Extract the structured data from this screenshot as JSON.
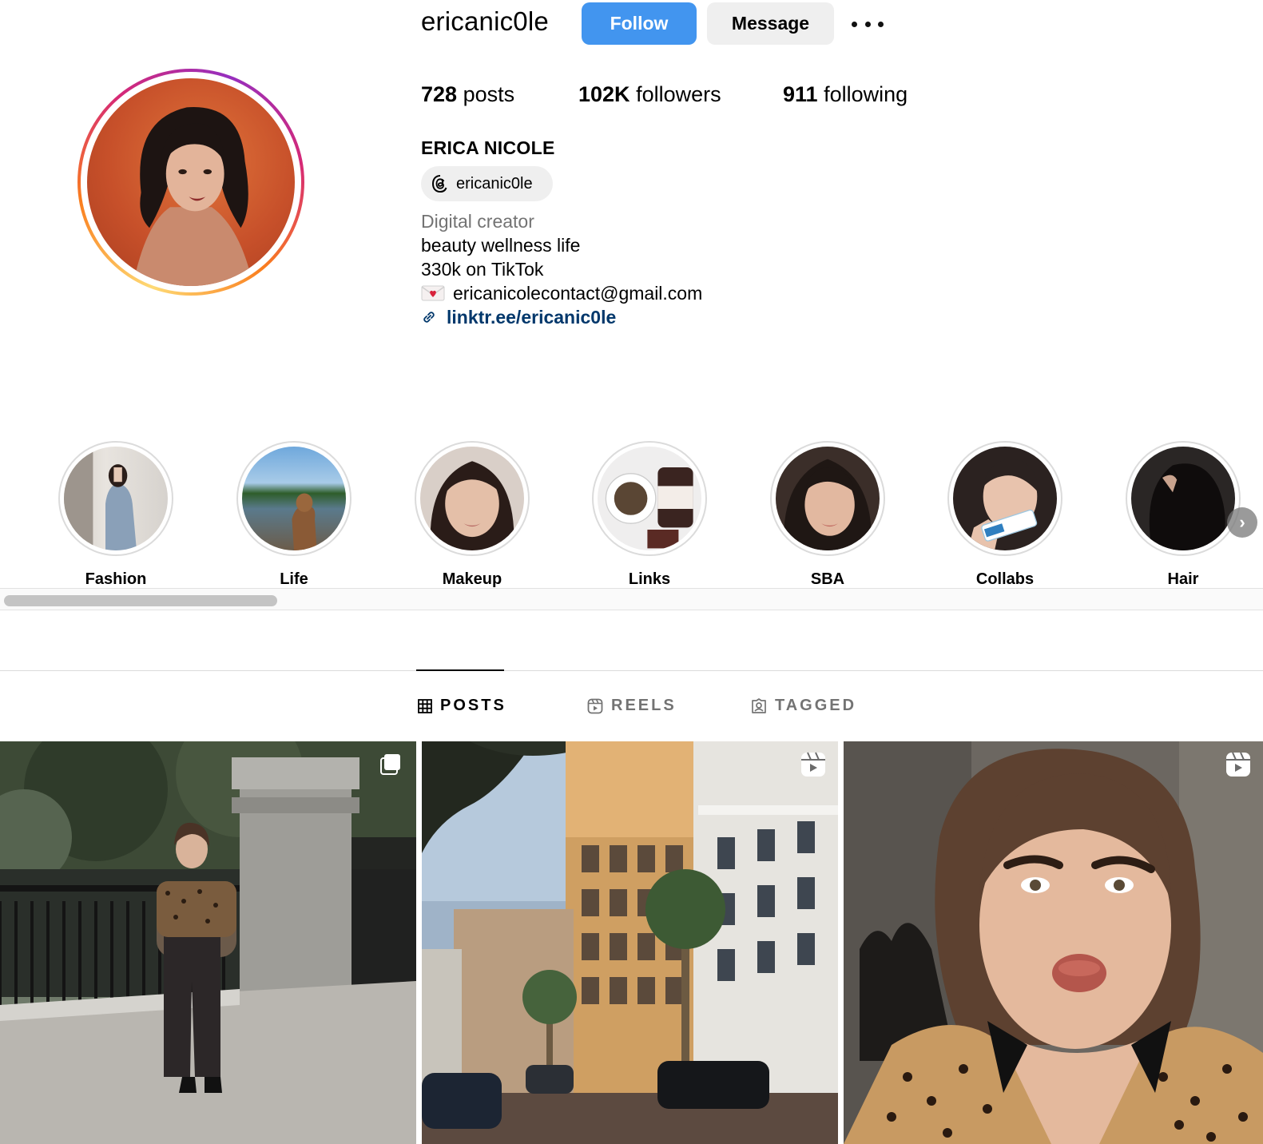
{
  "profile": {
    "username": "ericanic0le",
    "follow_label": "Follow",
    "message_label": "Message",
    "full_name": "ERICA NICOLE",
    "threads_handle": "ericanic0le",
    "category": "Digital creator",
    "bio_lines": [
      "beauty wellness life",
      "330k on TikTok",
      "ericanicolecontact@gmail.com"
    ],
    "link": "linktr.ee/ericanic0le"
  },
  "stats": {
    "posts_count": "728",
    "posts_label": "posts",
    "followers_count": "102K",
    "followers_label": "followers",
    "following_count": "911",
    "following_label": "following"
  },
  "highlights": [
    {
      "label": "Fashion"
    },
    {
      "label": "Life"
    },
    {
      "label": "Makeup"
    },
    {
      "label": "Links"
    },
    {
      "label": "SBA"
    },
    {
      "label": "Collabs"
    },
    {
      "label": "Hair"
    }
  ],
  "tabs": [
    {
      "label": "POSTS",
      "icon": "grid-icon",
      "active": true
    },
    {
      "label": "REELS",
      "icon": "reels-icon",
      "active": false
    },
    {
      "label": "TAGGED",
      "icon": "tagged-icon",
      "active": false
    }
  ],
  "posts": [
    {
      "type": "multi",
      "badge_icon": "carousel-icon"
    },
    {
      "type": "reel",
      "badge_icon": "reels-icon"
    },
    {
      "type": "reel",
      "badge_icon": "reels-icon"
    }
  ],
  "colors": {
    "accent": "#4295ef",
    "link": "#00376b",
    "muted": "#737373"
  }
}
